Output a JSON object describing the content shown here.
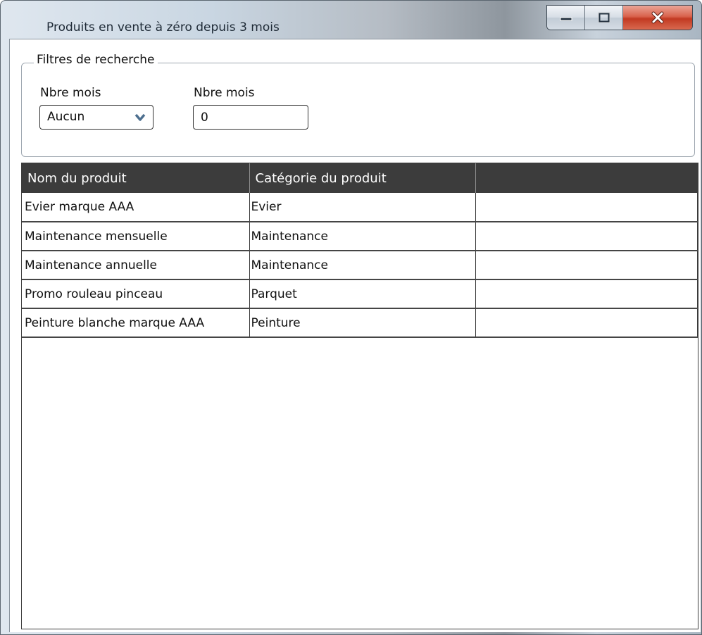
{
  "window": {
    "title": "Produits en vente à zéro depuis 3 mois"
  },
  "filters": {
    "legend": "Filtres de recherche",
    "months_select": {
      "label": "Nbre mois",
      "selected": "Aucun"
    },
    "months_input": {
      "label": "Nbre mois",
      "value": "0"
    }
  },
  "table": {
    "columns": [
      "Nom du produit",
      "Catégorie du produit",
      ""
    ],
    "rows": [
      {
        "name": "Evier marque AAA",
        "category": "Evier",
        "extra": ""
      },
      {
        "name": "Maintenance mensuelle",
        "category": "Maintenance",
        "extra": ""
      },
      {
        "name": "Maintenance annuelle",
        "category": "Maintenance",
        "extra": ""
      },
      {
        "name": "Promo rouleau pinceau",
        "category": "Parquet",
        "extra": ""
      },
      {
        "name": "Peinture blanche marque AAA",
        "category": "Peinture",
        "extra": ""
      }
    ]
  },
  "icons": {
    "minimize": "minimize-icon",
    "maximize": "maximize-icon",
    "close": "close-icon",
    "dropdown": "chevron-down-icon"
  },
  "colors": {
    "header_bg": "#3c3c3c",
    "close_button": "#c94a32"
  }
}
